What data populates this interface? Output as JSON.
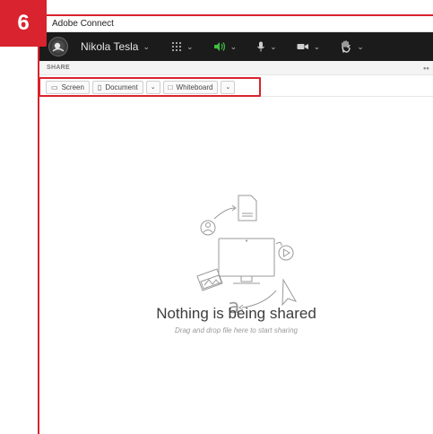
{
  "step_badge": "6",
  "window": {
    "title": "Adobe Connect"
  },
  "topbar": {
    "user_name": "Nikola Tesla",
    "icons": [
      "apps-grid-icon",
      "speaker-icon",
      "microphone-icon",
      "camera-icon",
      "raise-hand-icon"
    ],
    "audio_color": "#3fbf3f"
  },
  "share_pod": {
    "header": "SHARE",
    "buttons": {
      "screen": "Screen",
      "document": "Document",
      "whiteboard": "Whiteboard"
    }
  },
  "empty_state": {
    "title": "Nothing is being shared",
    "subtitle": "Drag and drop file here to start sharing"
  }
}
